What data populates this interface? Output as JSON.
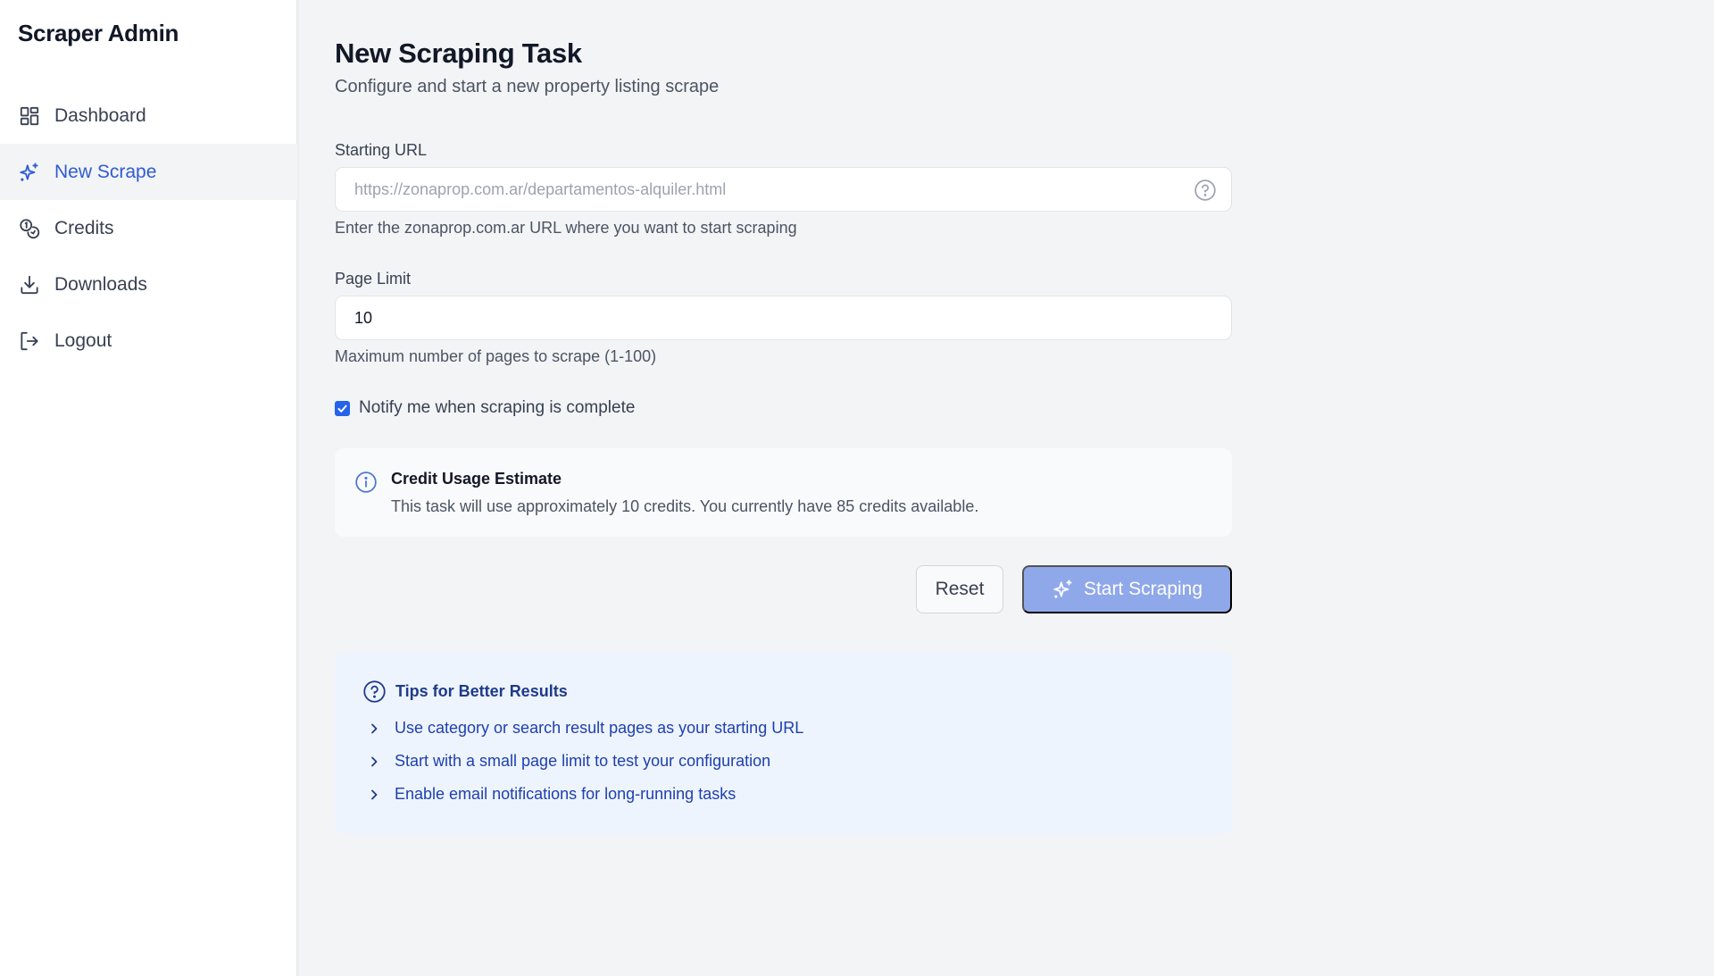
{
  "app": {
    "title": "Scraper Admin"
  },
  "sidebar": {
    "items": [
      {
        "label": "Dashboard",
        "icon": "dashboard-grid-icon",
        "active": false
      },
      {
        "label": "New Scrape",
        "icon": "sparkles-icon",
        "active": true
      },
      {
        "label": "Credits",
        "icon": "coins-icon",
        "active": false
      },
      {
        "label": "Downloads",
        "icon": "download-icon",
        "active": false
      },
      {
        "label": "Logout",
        "icon": "logout-icon",
        "active": false
      }
    ]
  },
  "page": {
    "title": "New Scraping Task",
    "subtitle": "Configure and start a new property listing scrape"
  },
  "form": {
    "starting_url": {
      "label": "Starting URL",
      "value": "",
      "placeholder": "https://zonaprop.com.ar/departamentos-alquiler.html",
      "hint": "Enter the zonaprop.com.ar URL where you want to start scraping",
      "help_icon": "question-circle-icon"
    },
    "page_limit": {
      "label": "Page Limit",
      "value": "10",
      "hint": "Maximum number of pages to scrape (1-100)"
    },
    "notify": {
      "label": "Notify me when scraping is complete",
      "checked": true
    }
  },
  "estimate": {
    "title": "Credit Usage Estimate",
    "text": "This task will use approximately 10 credits. You currently have 85 credits available.",
    "credits_needed": 10,
    "credits_available": 85,
    "icon": "info-circle-icon"
  },
  "actions": {
    "reset_label": "Reset",
    "start_label": "Start Scraping",
    "start_disabled": true
  },
  "tips": {
    "title": "Tips for Better Results",
    "icon": "question-circle-icon",
    "items": [
      "Use category or search result pages as your starting URL",
      "Start with a small page limit to test your configuration",
      "Enable email notifications for long-running tasks"
    ]
  },
  "colors": {
    "accent": "#2f5bd3",
    "primary_button_disabled": "#8fa8ea",
    "checkbox": "#2563eb",
    "tips_background": "#eef4fd",
    "tips_text": "#1e40af",
    "page_background": "#f3f4f6"
  }
}
